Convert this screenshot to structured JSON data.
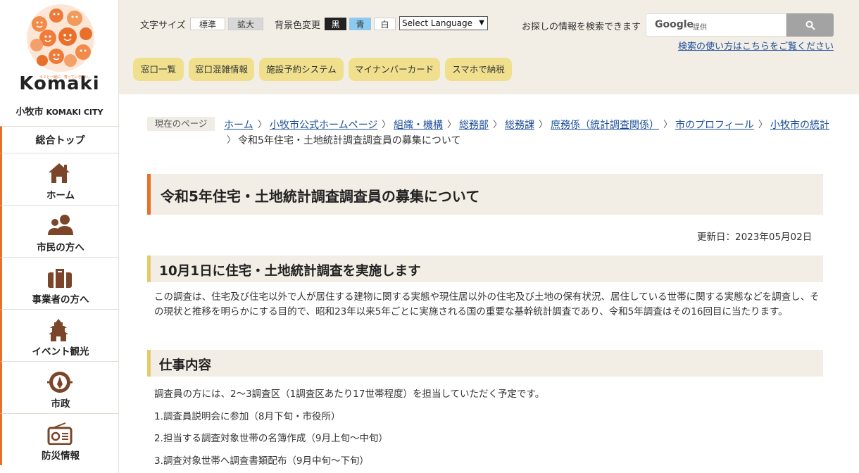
{
  "sidebar": {
    "logo": {
      "word": "Komaki",
      "tagline": "キミと一緒に、育っていきたい。",
      "city_ja": "小牧市",
      "city_en": "KOMAKI CITY"
    },
    "top_label": "総合トップ",
    "items": [
      {
        "label": "ホーム",
        "icon": "home-icon"
      },
      {
        "label": "市民の方へ",
        "icon": "people-icon"
      },
      {
        "label": "事業者の方へ",
        "icon": "briefcase-icon"
      },
      {
        "label": "イベント観光",
        "icon": "castle-icon"
      },
      {
        "label": "市政",
        "icon": "city-emblem-icon"
      },
      {
        "label": "防災情報",
        "icon": "radio-icon"
      }
    ]
  },
  "header": {
    "font_size_label": "文字サイズ",
    "font_size_options": [
      "標準",
      "拡大"
    ],
    "bg_label": "背景色変更",
    "bg_options": [
      "黒",
      "青",
      "白"
    ],
    "language_select": "Select Language",
    "search_hint": "お探しの情報を検索できます",
    "search_provider": "Google",
    "search_provider_suffix": "提供",
    "search_help": "検索の使い方はこちらをご覧ください",
    "quick_links": [
      "窓口一覧",
      "窓口混雑情報",
      "施設予約システム",
      "マイナンバーカード",
      "スマホで納税"
    ]
  },
  "breadcrumb": {
    "label": "現在のページ",
    "links": [
      "ホーム",
      "小牧市公式ホームページ",
      "組織・機構",
      "総務部",
      "総務課",
      "庶務係（統計調査関係）",
      "市のプロフィール",
      "小牧市の統計"
    ],
    "current": "令和5年住宅・土地統計調査調査員の募集について"
  },
  "content": {
    "title": "令和5年住宅・土地統計調査調査員の募集について",
    "updated": "更新日：2023年05月02日",
    "section1": {
      "heading": "10月1日に住宅・土地統計調査を実施します",
      "body": "この調査は、住宅及び住宅以外で人が居住する建物に関する実態や現住居以外の住宅及び土地の保有状況、居住している世帯に関する実態などを調査し、その現状と推移を明らかにする目的で、昭和23年以来5年ごとに実施される国の重要な基幹統計調査であり、令和5年調査はその16回目に当たります。"
    },
    "section2": {
      "heading": "仕事内容",
      "intro": "調査員の方には、2〜3調査区（1調査区あたり17世帯程度）を担当していただく予定です。",
      "items": [
        "1.調査員説明会に参加（8月下旬・市役所）",
        "2.担当する調査対象世帯の名簿作成（9月上旬〜中旬）",
        "3.調査対象世帯へ調査書類配布（9月中旬〜下旬）"
      ]
    }
  },
  "colors": {
    "accent_orange": "#e9702a",
    "header_bg": "#f3eee5",
    "quick_link_bg": "#f0e08e",
    "heading_bar_yellow": "#e6c96a",
    "link_blue": "#1a4d99",
    "nav_icon_brown": "#7a4528"
  }
}
